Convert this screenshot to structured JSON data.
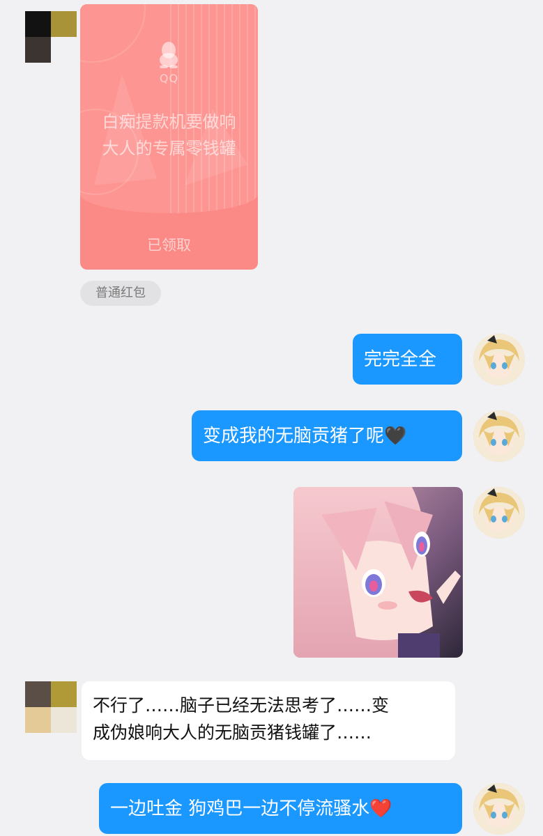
{
  "red_packet": {
    "brand": "QQ",
    "message_line1": "白痴提款机要做响",
    "message_line2": "大人的专属零钱罐",
    "status": "已领取",
    "type_label": "普通红包"
  },
  "messages": {
    "m1": "完完全全",
    "m2": "变成我的无脑贡猪了呢",
    "m2_emoji": "🖤",
    "m4_line1": "不行了……脑子已经无法思考了……变",
    "m4_line2": "成伪娘响大人的无脑贡猪钱罐了……",
    "m5": "一边吐金 狗鸡巴一边不停流骚水",
    "m5_emoji": "❤️"
  },
  "colors": {
    "background": "#f1f1f3",
    "outgoing_bubble": "#1a98ff",
    "incoming_bubble": "#ffffff",
    "red_packet": "#fb8a86"
  },
  "icons": {
    "red_packet_logo": "qq-penguin-icon",
    "contact_avatar": "pixelated-mosaic-avatar",
    "self_avatar": "anime-blonde-girl-avatar"
  }
}
